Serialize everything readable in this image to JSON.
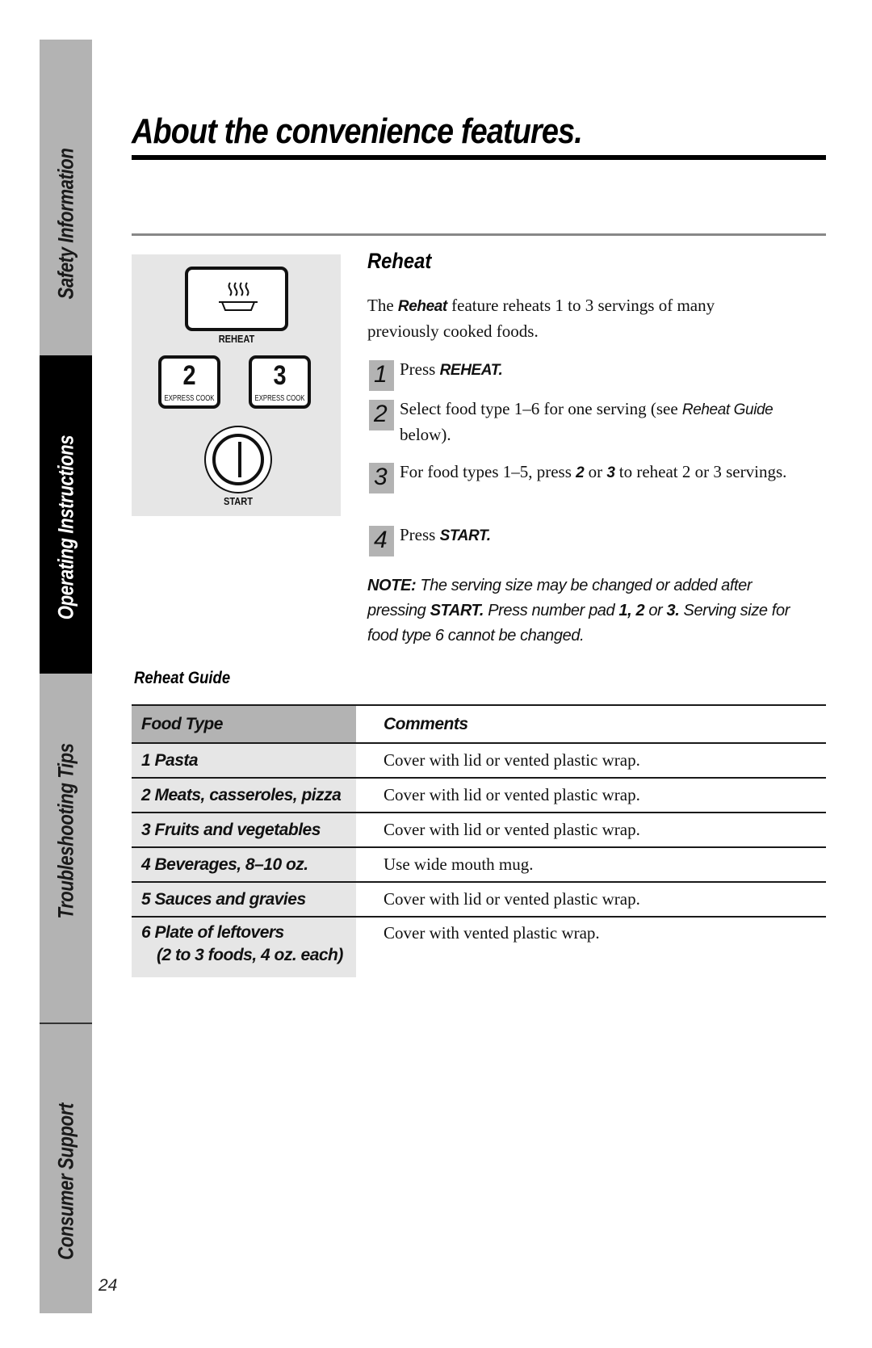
{
  "sidebar": {
    "tabs": [
      {
        "label": "Safety Information",
        "active": false
      },
      {
        "label": "Operating Instructions",
        "active": true
      },
      {
        "label": "Troubleshooting Tips",
        "active": false
      },
      {
        "label": "Consumer Support",
        "active": false
      }
    ]
  },
  "page": {
    "title": "About the convenience features.",
    "number": "24"
  },
  "control_panel": {
    "reheat_key_label": "REHEAT",
    "key_2_number": "2",
    "key_2_sub": "EXPRESS COOK",
    "key_3_number": "3",
    "key_3_sub": "EXPRESS COOK",
    "start_label": "START"
  },
  "reheat": {
    "heading": "Reheat",
    "intro": {
      "prefix": "The ",
      "feature": "Reheat",
      "suffix": " feature reheats 1 to 3 servings of many previously cooked foods."
    },
    "steps": [
      {
        "num": "1",
        "pre": "Press ",
        "bold": "REHEAT."
      },
      {
        "num": "2",
        "pre": "Select food type 1–6 for one serving (see ",
        "italic": "Reheat Guide",
        "post": " below)."
      },
      {
        "num": "3",
        "pre": "For food types 1–5, press ",
        "b1": "2",
        "mid": " or ",
        "b2": "3",
        "post": "  to reheat 2 or 3 servings."
      },
      {
        "num": "4",
        "pre": "Press ",
        "bold": "START."
      }
    ],
    "note": {
      "label": "NOTE:",
      "t1": " The serving size may be changed or added after pressing ",
      "b1": "START.",
      "t2": " Press number pad ",
      "b2": "1, 2",
      "t3": " or ",
      "b3": "3.",
      "t4": " Serving size for food type 6 cannot be changed."
    }
  },
  "guide": {
    "title": "Reheat Guide",
    "columns": [
      "Food Type",
      "Comments"
    ],
    "rows": [
      {
        "food": "1  Pasta",
        "comment": "Cover with lid or vented plastic wrap."
      },
      {
        "food": "2  Meats, casseroles, pizza",
        "comment": "Cover with lid or vented plastic wrap."
      },
      {
        "food": "3  Fruits and vegetables",
        "comment": "Cover with lid or vented plastic wrap."
      },
      {
        "food": "4  Beverages, 8–10 oz.",
        "comment": "Use wide mouth mug."
      },
      {
        "food": "5  Sauces and gravies",
        "comment": "Cover with lid or vented plastic wrap."
      },
      {
        "food": "6  Plate of leftovers",
        "food_sub": "(2 to 3 foods, 4 oz. each)",
        "comment": "Cover with vented plastic wrap."
      }
    ]
  }
}
